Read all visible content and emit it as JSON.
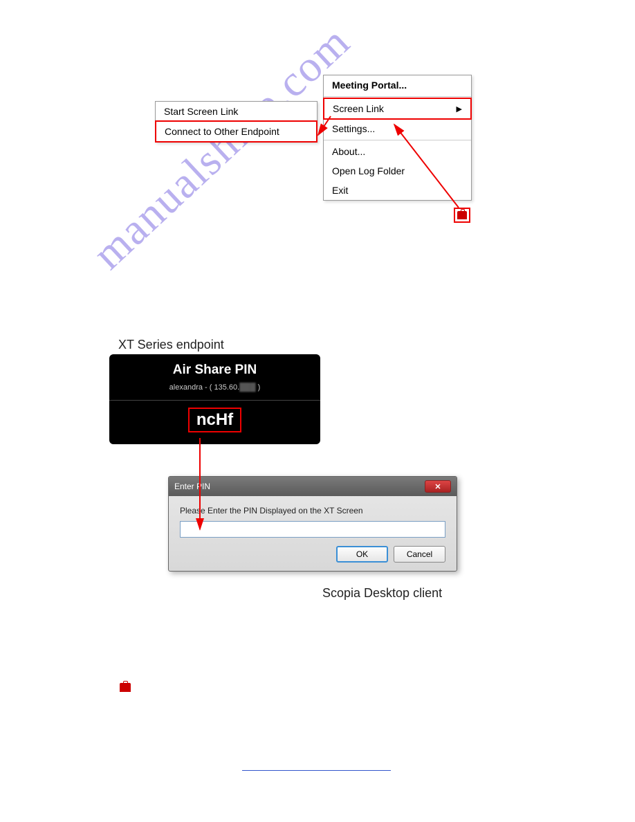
{
  "mainMenu": {
    "items": [
      {
        "label": "Meeting Portal...",
        "bold": true
      },
      {
        "label": "Screen Link",
        "highlighted": true,
        "hasSubmenu": true
      },
      {
        "label": "Settings..."
      },
      {
        "label": "About..."
      },
      {
        "label": "Open Log Folder"
      },
      {
        "label": "Exit"
      }
    ]
  },
  "submenu": {
    "items": [
      {
        "label": "Start Screen Link"
      },
      {
        "label": "Connect to Other Endpoint",
        "highlighted": true
      }
    ]
  },
  "xtSection": {
    "heading": "XT Series endpoint",
    "title": "Air Share PIN",
    "subtitle": "alexandra - ( 135.60.",
    "subtitleSuffix": " )",
    "pin": "ncHf"
  },
  "pinDialog": {
    "title": "Enter PIN",
    "prompt": "Please Enter the PIN Displayed on the XT Screen",
    "ok": "OK",
    "cancel": "Cancel"
  },
  "scopiaLabel": "Scopia Desktop client",
  "watermark": "manualshive.com"
}
